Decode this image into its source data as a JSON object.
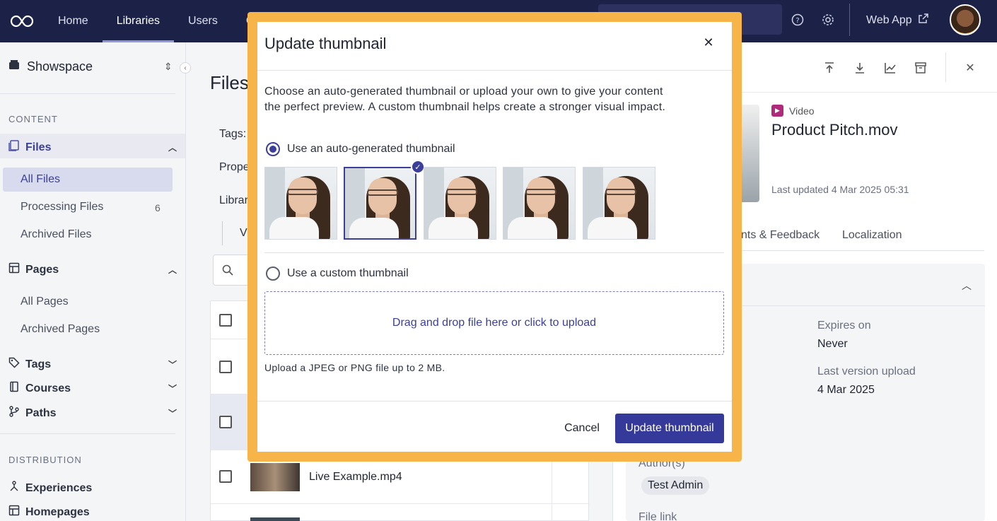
{
  "topnav": {
    "items": [
      "Home",
      "Libraries",
      "Users",
      "C"
    ],
    "active": "Libraries",
    "webapp_label": "Web App"
  },
  "sidebar": {
    "workspace": "Showspace",
    "content_section": "CONTENT",
    "files_group": "Files",
    "file_items": [
      {
        "label": "All Files"
      },
      {
        "label": "Processing Files",
        "count": "6"
      },
      {
        "label": "Archived Files"
      }
    ],
    "pages_group": "Pages",
    "page_items": [
      "All Pages",
      "Archived Pages"
    ],
    "tags": "Tags",
    "courses": "Courses",
    "paths": "Paths",
    "distribution_section": "DISTRIBUTION",
    "experiences": "Experiences",
    "homepages": "Homepages"
  },
  "main": {
    "title": "Files",
    "tags_label": "Tags:",
    "props_label": "Prope",
    "library_label": "Librar",
    "view_label": "V",
    "rows": [
      {
        "name": "Live Example.mp4"
      }
    ]
  },
  "panel": {
    "file_type": "Video",
    "file_name": "Product Pitch.mov",
    "last_updated": "Last updated 4 Mar 2025 05:31",
    "tabs": [
      "nts & Feedback",
      "Localization"
    ],
    "expires_label": "Expires on",
    "expires_value": "Never",
    "last_upload_label": "Last version upload",
    "last_upload_value": "4 Mar 2025",
    "authors_label": "Author(s)",
    "author": "Test Admin",
    "file_link_label": "File link"
  },
  "modal": {
    "title": "Update thumbnail",
    "description": "Choose an auto-generated thumbnail or upload your own to give your content the perfect preview. A custom thumbnail helps create a stronger visual impact.",
    "auto_option": "Use an auto-generated thumbnail",
    "custom_option": "Use a custom thumbnail",
    "selected_option": "auto",
    "selected_thumbnail": 2,
    "thumbnail_count": 5,
    "dropzone_text": "Drag and drop file here or click to upload",
    "hint": "Upload a JPEG or PNG file up to 2 MB.",
    "cancel_label": "Cancel",
    "submit_label": "Update thumbnail"
  },
  "colors": {
    "nav_bg": "#1c2148",
    "primary": "#353a9a",
    "modal_highlight": "#f6b449"
  }
}
